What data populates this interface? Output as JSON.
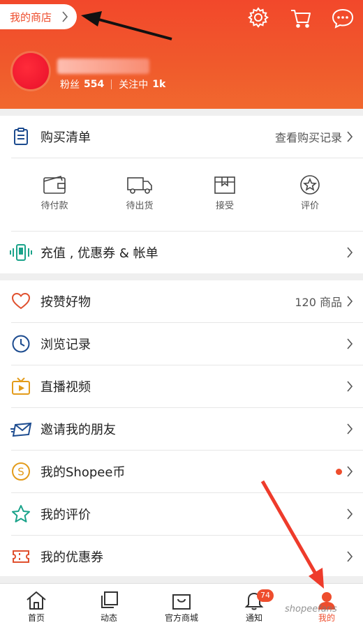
{
  "header": {
    "shop_label": "我的商店",
    "followers_label": "粉丝",
    "followers_count": "554",
    "following_label": "关注中",
    "following_count": "1k",
    "accent_color": "#ee4d2d"
  },
  "purchase": {
    "title": "购买清单",
    "view_history": "查看购买记录",
    "statuses": [
      {
        "label": "待付款",
        "icon": "wallet-icon"
      },
      {
        "label": "待出货",
        "icon": "truck-icon"
      },
      {
        "label": "接受",
        "icon": "box-icon"
      },
      {
        "label": "评价",
        "icon": "star-circle-icon"
      }
    ]
  },
  "topup": {
    "label": "充值 , 优惠券 & 帐单",
    "icon": "phone-vibrate-icon"
  },
  "menu": [
    {
      "label": "按赞好物",
      "right": "120 商品",
      "icon": "heart-icon"
    },
    {
      "label": "浏览记录",
      "right": "",
      "icon": "clock-icon"
    },
    {
      "label": "直播视频",
      "right": "",
      "icon": "tv-icon"
    },
    {
      "label": "邀请我的朋友",
      "right": "",
      "icon": "mail-icon"
    },
    {
      "label": "我的Shopee币",
      "right": "",
      "icon": "coin-icon"
    },
    {
      "label": "我的评价",
      "right": "",
      "icon": "star-outline-icon"
    },
    {
      "label": "我的优惠券",
      "right": "",
      "icon": "ticket-icon"
    }
  ],
  "tabs": [
    {
      "label": "首页",
      "icon": "home-icon"
    },
    {
      "label": "动态",
      "icon": "feed-icon"
    },
    {
      "label": "官方商城",
      "icon": "mall-bag-icon"
    },
    {
      "label": "通知",
      "icon": "bell-icon",
      "badge": "74"
    },
    {
      "label": "我的",
      "icon": "person-icon",
      "active": true
    }
  ],
  "watermark": "shopeefans"
}
